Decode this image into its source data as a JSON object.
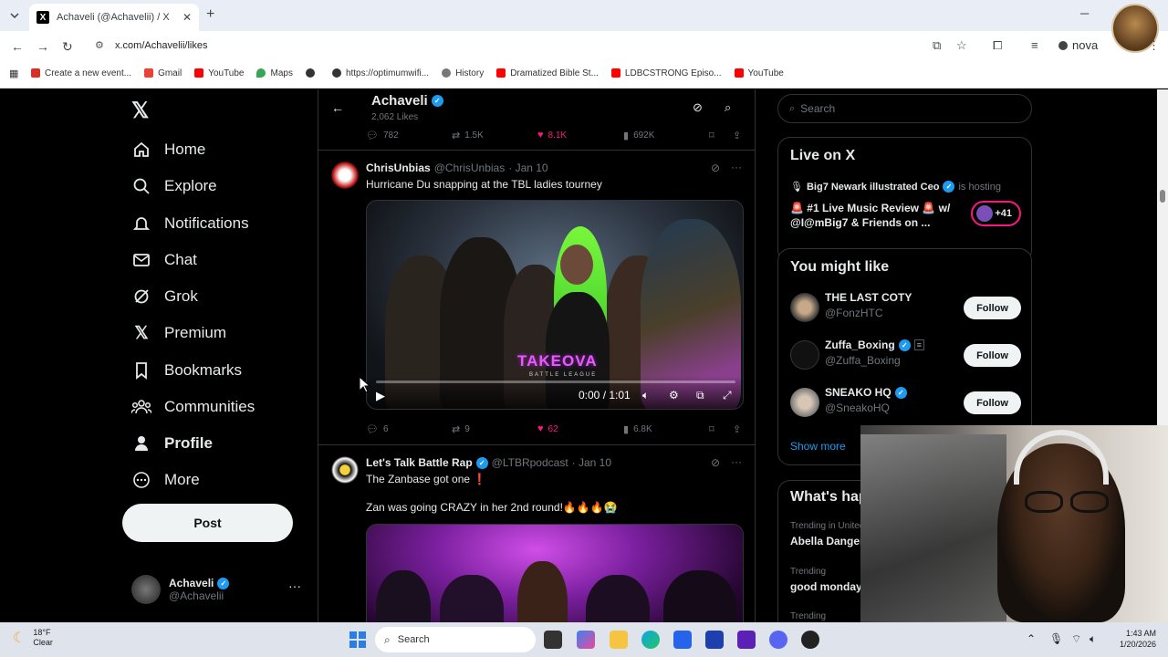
{
  "browser": {
    "tab_title": "Achaveli (@Achavelii) / X",
    "url": "x.com/Achavelii/likes",
    "new_tab": "+",
    "profile": "nova",
    "bookmarks": [
      {
        "label": "Create a new event...",
        "color": "#d93025"
      },
      {
        "label": "Gmail",
        "color": "#ea4335"
      },
      {
        "label": "YouTube",
        "color": "#ff0000"
      },
      {
        "label": "Maps",
        "color": "#34a853"
      },
      {
        "label": "",
        "color": "#333333"
      },
      {
        "label": "https://optimumwifi...",
        "color": "#333333"
      },
      {
        "label": "History",
        "color": "#555555"
      },
      {
        "label": "Dramatized Bible St...",
        "color": "#ff0000"
      },
      {
        "label": "LDBCSTRONG Episo...",
        "color": "#ff0000"
      },
      {
        "label": "YouTube",
        "color": "#ff0000"
      }
    ]
  },
  "nav": {
    "items": [
      {
        "label": "Home",
        "icon": "home-icon"
      },
      {
        "label": "Explore",
        "icon": "search-icon"
      },
      {
        "label": "Notifications",
        "icon": "bell-icon"
      },
      {
        "label": "Chat",
        "icon": "mail-icon"
      },
      {
        "label": "Grok",
        "icon": "grok-icon"
      },
      {
        "label": "Premium",
        "icon": "x-icon"
      },
      {
        "label": "Bookmarks",
        "icon": "bookmark-icon"
      },
      {
        "label": "Communities",
        "icon": "people-icon"
      },
      {
        "label": "Profile",
        "icon": "person-icon"
      },
      {
        "label": "More",
        "icon": "more-circle-icon"
      }
    ],
    "post_label": "Post",
    "account": {
      "name": "Achaveli",
      "handle": "@Achavelii",
      "more": "···"
    }
  },
  "header": {
    "name": "Achaveli",
    "count": "2,062 Likes"
  },
  "top_actions": {
    "replies": "782",
    "reposts": "1.5K",
    "likes": "8.1K",
    "views": "692K"
  },
  "tweets": [
    {
      "author": "ChrisUnbias",
      "handle": "@ChrisUnbias",
      "date": "· Jan 10",
      "text": "Hurricane Du snapping at the TBL ladies tourney",
      "video": {
        "logo": "TAKEOVA",
        "sub": "BATTLE LEAGUE",
        "time": "0:00 / 1:01"
      },
      "actions": {
        "replies": "6",
        "reposts": "9",
        "likes": "62",
        "views": "6.8K"
      }
    },
    {
      "author": "Let's Talk Battle Rap",
      "handle": "@LTBRpodcast",
      "date": "· Jan 10",
      "text": "The Zanbase got one",
      "text2": "Zan was going CRAZY in her 2nd round!🔥🔥🔥😭"
    }
  ],
  "right": {
    "search_placeholder": "Search",
    "live": {
      "title": "Live on X",
      "host": "Big7 Newark illustrated Ceo",
      "is_hosting": "is hosting",
      "space_title": "🚨 #1 Live Music Review 🚨 w/ @I@mBig7 & Friends on ...",
      "plus": "+41"
    },
    "might_like": {
      "title": "You might like",
      "users": [
        {
          "name": "THE LAST COTY",
          "handle": "@FonzHTC",
          "follow": "Follow"
        },
        {
          "name": "Zuffa_Boxing",
          "handle": "@Zuffa_Boxing",
          "follow": "Follow"
        },
        {
          "name": "SNEAKO HQ",
          "handle": "@SneakoHQ",
          "follow": "Follow"
        }
      ],
      "show_more": "Show more"
    },
    "happening": {
      "title": "What's happening",
      "trends": [
        {
          "context": "Trending in United States",
          "topic": "Abella Danger"
        },
        {
          "context": "Trending",
          "topic": "good monday"
        },
        {
          "context": "Trending",
          "topic": ""
        }
      ]
    }
  },
  "taskbar": {
    "weather_temp": "18°F",
    "weather_desc": "Clear",
    "search": "Search",
    "time": "1:43 AM",
    "date": "1/20/2026"
  },
  "colors": {
    "accent": "#1d9bf0",
    "like": "#f91880",
    "bg": "#000000"
  }
}
